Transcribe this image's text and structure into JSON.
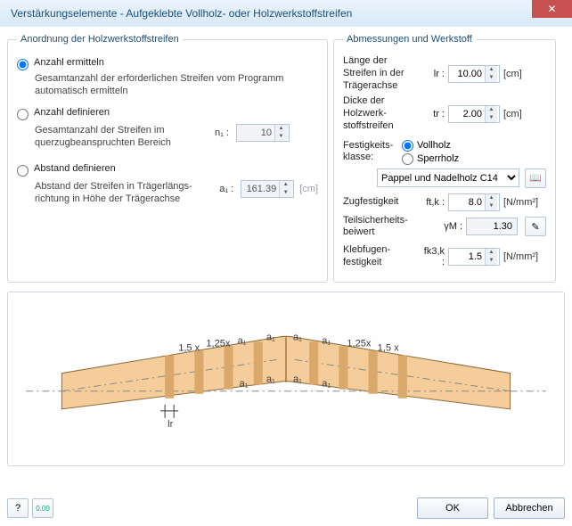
{
  "title": "Verstärkungselemente - Aufgeklebte Vollholz- oder Holzwerkstoffstreifen",
  "left": {
    "legend": "Anordnung der Holzwerkstoffstreifen",
    "opt1": {
      "label": "Anzahl ermitteln",
      "desc": "Gesamtanzahl der erforderlichen Streifen vom Programm automatisch ermitteln"
    },
    "opt2": {
      "label": "Anzahl definieren",
      "desc": "Gesamtanzahl der Streifen im querzugbeanspruchten Bereich",
      "sym": "n₁ :",
      "val": "10"
    },
    "opt3": {
      "label": "Abstand definieren",
      "desc": "Abstand der Streifen in Trägerlängs-richtung in Höhe der Trägerachse",
      "sym": "a₁ :",
      "val": "161.39",
      "unit": "[cm]"
    }
  },
  "right": {
    "legend": "Abmessungen und Werkstoff",
    "len": {
      "label": "Länge der Streifen in der Trägerachse",
      "sym": "lr :",
      "val": "10.00",
      "unit": "[cm]"
    },
    "thick": {
      "label": "Dicke der Holzwerk-stoffstreifen",
      "sym": "tr :",
      "val": "2.00",
      "unit": "[cm]"
    },
    "fk": {
      "label": "Festigkeits-klasse:",
      "r1": "Vollholz",
      "r2": "Sperrholz",
      "sel": "Pappel und Nadelholz C14"
    },
    "zug": {
      "label": "Zugfestigkeit",
      "sym": "ft,k :",
      "val": "8.0",
      "unit": "[N/mm²]"
    },
    "teil": {
      "label": "Teilsicherheits-beiwert",
      "sym": "γM :",
      "val": "1.30"
    },
    "kleb": {
      "label": "Klebfugen-festigkeit",
      "sym": "fk3,k :",
      "val": "1.5",
      "unit": "[N/mm²]"
    }
  },
  "diagram": {
    "lr": "lr",
    "a1": "a₁",
    "m15": "1,5 x",
    "m125": "1,25x"
  },
  "buttons": {
    "ok": "OK",
    "cancel": "Abbrechen"
  }
}
